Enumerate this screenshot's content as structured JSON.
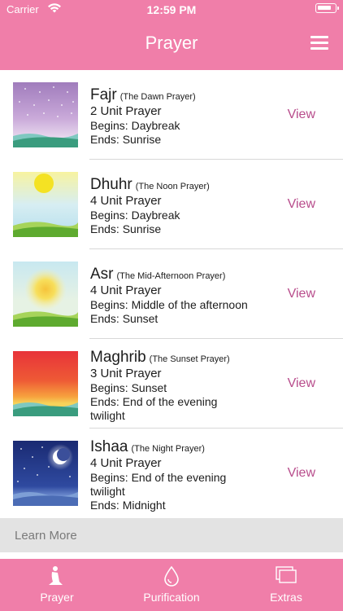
{
  "status_bar": {
    "carrier": "Carrier",
    "time": "12:59 PM"
  },
  "header": {
    "title": "Prayer"
  },
  "prayers": [
    {
      "name": "Fajr",
      "subtitle": "(The Dawn Prayer)",
      "units": "2 Unit Prayer",
      "begins": "Begins: Daybreak",
      "ends": "Ends: Sunrise",
      "view": "View",
      "image": "night-stars-dawn"
    },
    {
      "name": "Dhuhr",
      "subtitle": "(The Noon Prayer)",
      "units": "4 Unit Prayer",
      "begins": "Begins: Daybreak",
      "ends": "Ends: Sunrise",
      "view": "View",
      "image": "noon-sun"
    },
    {
      "name": "Asr",
      "subtitle": "(The Mid-Afternoon Prayer)",
      "units": "4 Unit Prayer",
      "begins": "Begins: Middle of the afternoon",
      "ends": "Ends: Sunset",
      "view": "View",
      "image": "afternoon-sun"
    },
    {
      "name": "Maghrib",
      "subtitle": "(The Sunset Prayer)",
      "units": "3 Unit Prayer",
      "begins": "Begins: Sunset",
      "ends": "Ends: End of the evening twilight",
      "view": "View",
      "image": "sunset"
    },
    {
      "name": "Ishaa",
      "subtitle": "(The Night Prayer)",
      "units": "4 Unit Prayer",
      "begins": "Begins: End of the evening twilight",
      "ends": "Ends: Midnight",
      "view": "View",
      "image": "night-moon"
    }
  ],
  "learn_more": "Learn More",
  "tabs": [
    {
      "label": "Prayer",
      "icon": "praying-person-icon"
    },
    {
      "label": "Purification",
      "icon": "water-drop-icon"
    },
    {
      "label": "Extras",
      "icon": "stacked-windows-icon"
    }
  ],
  "colors": {
    "accent": "#f07ea9",
    "link": "#b84d8c",
    "learn_more_bg": "#e3e3e3"
  }
}
